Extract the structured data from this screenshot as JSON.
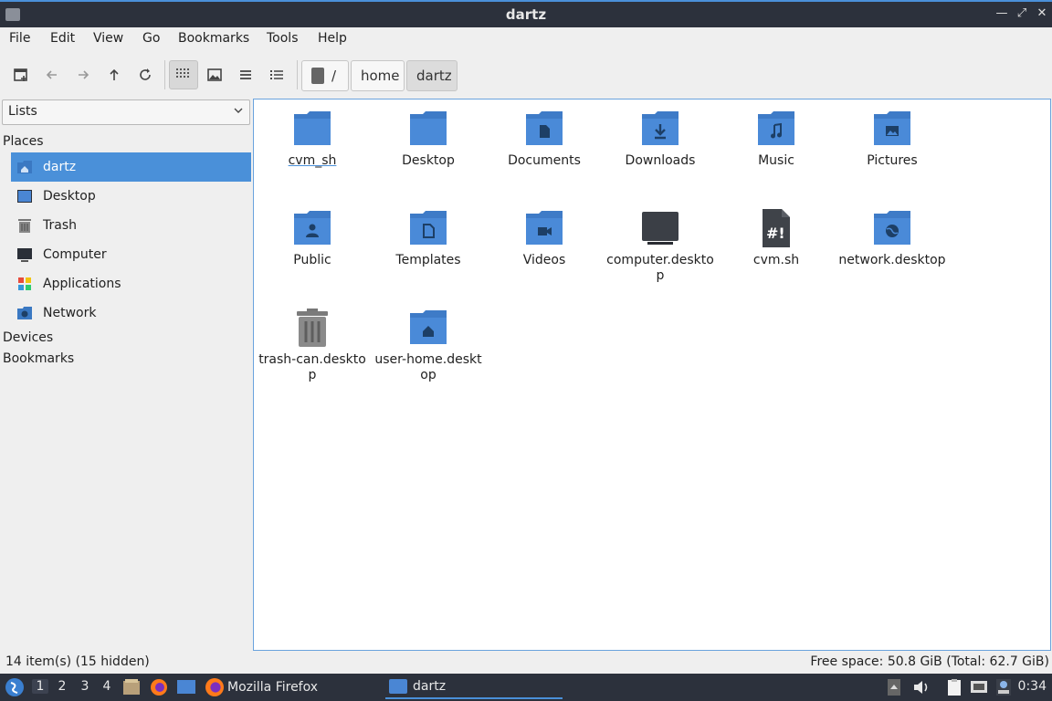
{
  "window": {
    "title": "dartz"
  },
  "menubar": [
    "File",
    "Edit",
    "View",
    "Go",
    "Bookmarks",
    "Tools",
    "Help"
  ],
  "toolbar": {
    "buttons": [
      "new-tab-icon",
      "back-icon",
      "forward-icon",
      "up-icon",
      "reload-icon",
      "icon-view-icon",
      "thumbnail-view-icon",
      "compact-view-icon",
      "detailed-list-view-icon"
    ],
    "active_view": "icon-view",
    "path": {
      "root": "/",
      "segments": [
        "home",
        "dartz"
      ]
    }
  },
  "sidebar": {
    "lists_select": "Lists",
    "places_label": "Places",
    "places": [
      {
        "label": "dartz",
        "icon": "home-folder-icon",
        "selected": true
      },
      {
        "label": "Desktop",
        "icon": "desktop-icon",
        "selected": false
      },
      {
        "label": "Trash",
        "icon": "trash-icon",
        "selected": false
      },
      {
        "label": "Computer",
        "icon": "computer-icon",
        "selected": false
      },
      {
        "label": "Applications",
        "icon": "applications-icon",
        "selected": false
      },
      {
        "label": "Network",
        "icon": "network-icon",
        "selected": false
      }
    ],
    "devices_label": "Devices",
    "bookmarks_label": "Bookmarks"
  },
  "files": [
    {
      "name": "cvm_sh",
      "icon": "folder-icon"
    },
    {
      "name": "Desktop",
      "icon": "folder-icon"
    },
    {
      "name": "Documents",
      "icon": "folder-documents-icon"
    },
    {
      "name": "Downloads",
      "icon": "folder-download-icon"
    },
    {
      "name": "Music",
      "icon": "folder-music-icon"
    },
    {
      "name": "Pictures",
      "icon": "folder-pictures-icon"
    },
    {
      "name": "Public",
      "icon": "folder-public-icon"
    },
    {
      "name": "Templates",
      "icon": "folder-templates-icon"
    },
    {
      "name": "Videos",
      "icon": "folder-videos-icon"
    },
    {
      "name": "computer.desktop",
      "icon": "monitor-icon"
    },
    {
      "name": "cvm.sh",
      "icon": "script-file-icon"
    },
    {
      "name": "network.desktop",
      "icon": "folder-network-icon"
    },
    {
      "name": "trash-can.desktop",
      "icon": "trash-can-icon"
    },
    {
      "name": "user-home.desktop",
      "icon": "folder-home-icon"
    }
  ],
  "statusbar": {
    "items": "14 item(s) (15 hidden)",
    "free_space": "Free space: 50.8 GiB (Total: 62.7 GiB)"
  },
  "taskbar": {
    "workspaces": [
      "1",
      "2",
      "3",
      "4"
    ],
    "active_workspace": "1",
    "tasks": [
      {
        "label": "Mozilla Firefox",
        "icon": "firefox-icon",
        "active": false
      },
      {
        "label": "dartz",
        "icon": "folder-icon",
        "active": true
      }
    ],
    "clock": "0:34"
  },
  "colors": {
    "accent": "#4a90d9",
    "folder": "#4a86d4",
    "titlebar": "#2c313c"
  }
}
